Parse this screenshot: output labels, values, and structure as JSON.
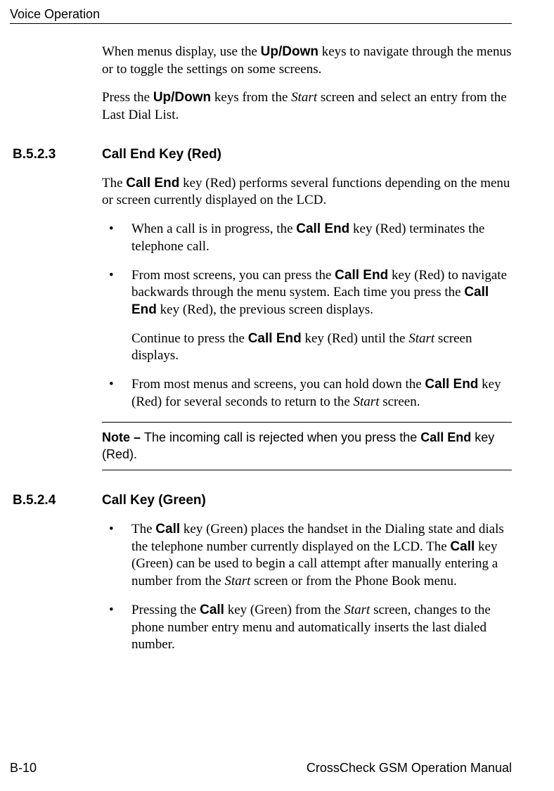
{
  "header": {
    "title": "Voice Operation"
  },
  "intro": {
    "para1_pre": "When menus display, use the ",
    "para1_bold": "Up/Down",
    "para1_post": " keys to navigate through the menus or to toggle the settings on some screens.",
    "para2_pre": "Press the ",
    "para2_bold": "Up/Down",
    "para2_mid": " keys from the ",
    "para2_italic": "Start",
    "para2_post": " screen and select an entry from the Last Dial List."
  },
  "section1": {
    "number": "B.5.2.3",
    "title": "Call End Key (Red)",
    "para_pre": "The ",
    "para_bold": "Call End",
    "para_post": " key (Red) performs several functions depending on the menu or screen currently displayed on the LCD.",
    "bullets": {
      "b1_pre": "When a call is in progress, the ",
      "b1_bold": "Call End",
      "b1_post": " key (Red) terminates the telephone call.",
      "b2_pre": "From most screens, you can press the ",
      "b2_bold1": "Call End",
      "b2_mid": " key (Red) to navigate backwards through the menu system. Each time you press the ",
      "b2_bold2": "Call End",
      "b2_post": " key (Red), the previous screen displays.",
      "b2_sub_pre": "Continue to press the ",
      "b2_sub_bold": "Call End",
      "b2_sub_mid": " key (Red) until the ",
      "b2_sub_italic": "Start",
      "b2_sub_post": " screen displays.",
      "b3_pre": "From most menus and screens, you can hold down the ",
      "b3_bold": "Call End",
      "b3_mid": " key (Red) for several seconds to return to the ",
      "b3_italic": "Start",
      "b3_post": " screen."
    },
    "note_label": "Note – ",
    "note_pre": "The incoming call is rejected when you press the ",
    "note_bold": "Call End",
    "note_post": " key (Red)."
  },
  "section2": {
    "number": "B.5.2.4",
    "title": "Call Key (Green)",
    "bullets": {
      "b1_pre": "The ",
      "b1_bold1": "Call",
      "b1_mid1": " key (Green) places the handset in the Dialing state and dials the telephone number currently displayed on the LCD. The ",
      "b1_bold2": "Call",
      "b1_mid2": " key (Green) can be used to begin a call attempt after manually entering a number from the ",
      "b1_italic": "Start",
      "b1_post": " screen or from the Phone Book menu.",
      "b2_pre": "Pressing the ",
      "b2_bold": "Call",
      "b2_mid": " key (Green) from the ",
      "b2_italic": "Start",
      "b2_post": " screen, changes to the phone number entry menu and automatically inserts the last dialed number."
    }
  },
  "footer": {
    "page": "B-10",
    "manual": "CrossCheck GSM Operation Manual"
  }
}
